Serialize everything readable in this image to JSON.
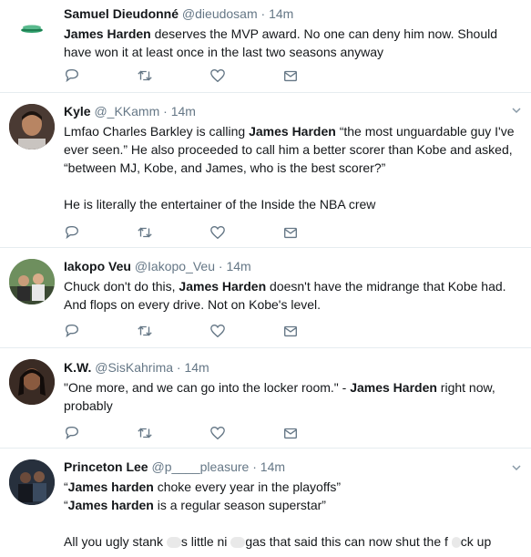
{
  "tweets": [
    {
      "name": "Samuel Dieudonné",
      "handle": "@dieudosam",
      "time": "14m",
      "avatar": "globe-logo",
      "text_parts": [
        {
          "bold": "James Harden"
        },
        {
          "plain": " deserves the MVP award. No one can deny him now. Should have won it at least once in the last two seasons anyway"
        }
      ]
    },
    {
      "name": "Kyle",
      "handle": "@_KKamm",
      "time": "14m",
      "avatar": "person-photo",
      "text_p1a": "Lmfao Charles Barkley is calling ",
      "text_p1b": "James Harden",
      "text_p1c": " “the most unguardable guy I've ever seen.” He also proceeded to call him a better scorer than Kobe and asked, “between MJ, Kobe, and James, who is the best scorer?”",
      "text_p2": "He is literally the entertainer of the Inside the NBA crew"
    },
    {
      "name": "Iakopo Veu",
      "handle": "@Iakopo_Veu",
      "time": "14m",
      "avatar": "group-photo",
      "text_a": "Chuck don't do this, ",
      "text_b": "James Harden",
      "text_c": " doesn't have the midrange that Kobe had. And flops on every drive. Not on Kobe's level."
    },
    {
      "name": "K.W.",
      "handle": "@SisKahrima",
      "time": "14m",
      "avatar": "person-photo",
      "text_a": "\"One more, and we can go into the locker room.\" - ",
      "text_b": "James Harden",
      "text_c": " right now, probably"
    },
    {
      "name": "Princeton Lee",
      "handle": "@p____pleasure",
      "time": "14m",
      "avatar": "person-photo",
      "line1_a": "“",
      "line1_b": "James harden",
      "line1_c": " choke every year in the playoffs”",
      "line2_a": "“",
      "line2_b": "James harden",
      "line2_c": " is a regular season superstar”",
      "line3_a": "All you ugly stank",
      "line3_b": "s little ni",
      "line3_c": "gas that said this can now shut the f",
      "line3_d": "ck up"
    }
  ],
  "dot": "·",
  "icons": {
    "reply": "reply-icon",
    "retweet": "retweet-icon",
    "like": "like-icon",
    "dm": "message-icon",
    "more": "chevron-down-icon"
  },
  "colors": {
    "text": "#14171a",
    "muted": "#657786",
    "icon": "#657786",
    "divider": "#e6ecf0"
  }
}
